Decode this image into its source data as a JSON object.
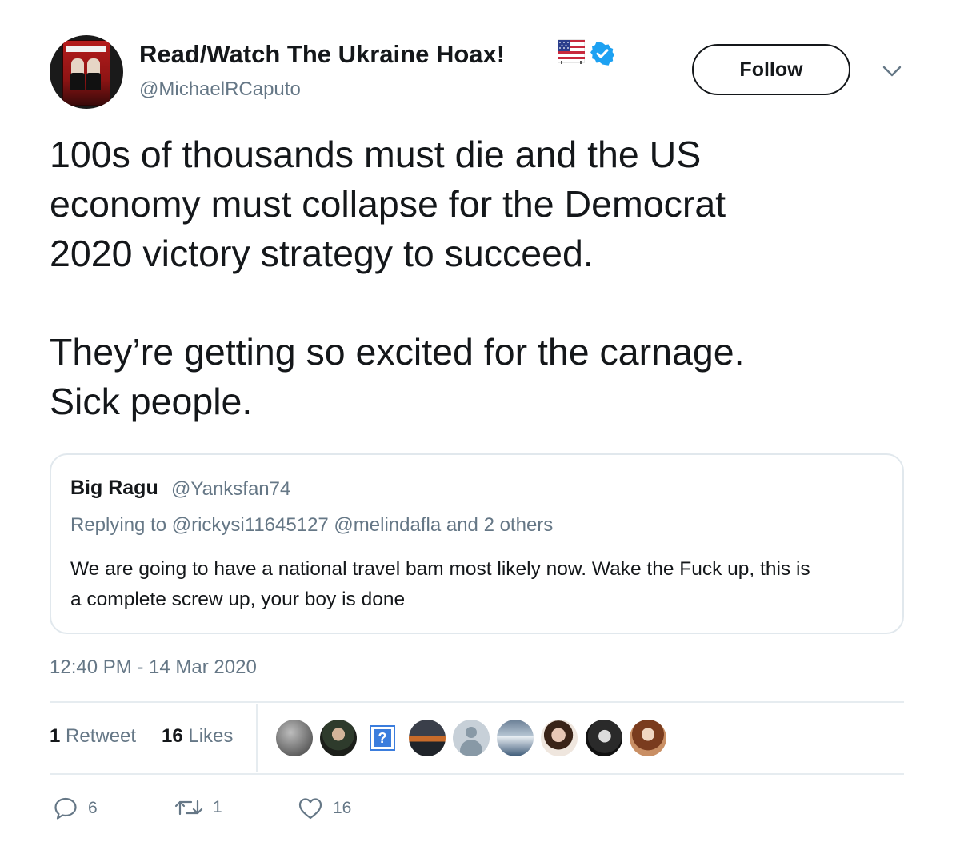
{
  "author": {
    "display_name": "Read/Watch The Ukraine Hoax!",
    "handle": "@MichaelRCaputo"
  },
  "follow_button": {
    "label": "Follow"
  },
  "tweet": {
    "lines": [
      "100s of thousands must die and the US",
      "economy must collapse for the Democrat",
      "2020 victory strategy to succeed.",
      "They’re getting so excited for the carnage.",
      "Sick people."
    ]
  },
  "quoted_tweet": {
    "name": "Big Ragu",
    "handle": "@Yanksfan74",
    "replying_to": "Replying to @rickysi11645127 @melindafla and 2 others",
    "text_lines": [
      "We are going to have a national travel bam most likely now. Wake the Fuck up, this is",
      "a complete screw up, your boy is done"
    ]
  },
  "timestamp": "12:40 PM - 14 Mar 2020",
  "stats": {
    "retweets_count": "1",
    "retweets_label": "Retweet",
    "likes_count": "16",
    "likes_label": "Likes"
  },
  "actions": {
    "reply_count": "6",
    "retweet_count": "1",
    "like_count": "16"
  },
  "icons": {
    "verified": "verified-badge-icon",
    "flag": "us-flag-emoji",
    "chevron": "chevron-down-icon",
    "reply": "reply-icon",
    "retweet": "retweet-icon",
    "like": "heart-icon"
  },
  "colors": {
    "text": "#14171a",
    "secondary": "#657786",
    "verified": "#1da1f2",
    "border": "#e1e8ed"
  }
}
